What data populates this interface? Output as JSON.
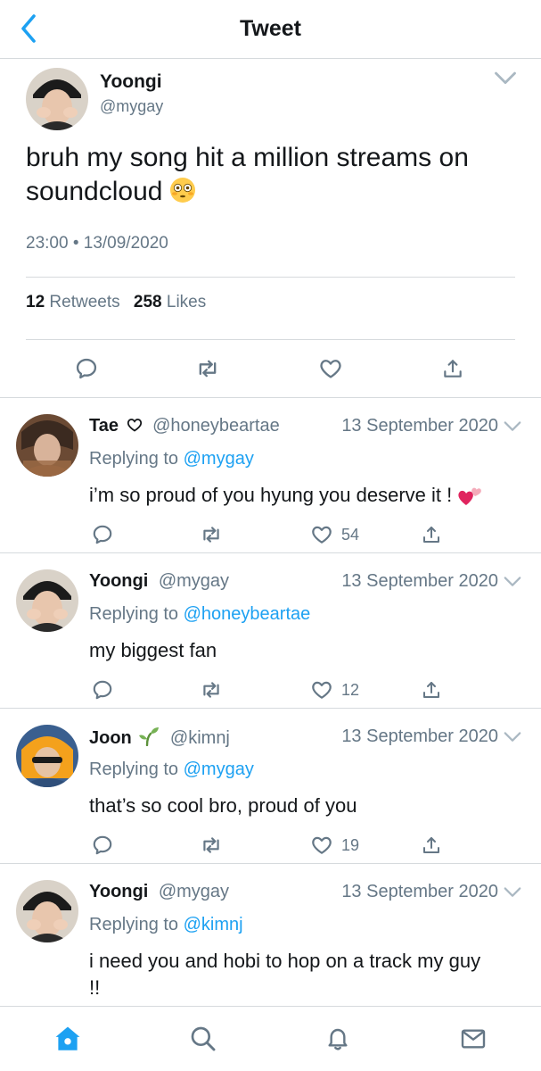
{
  "header": {
    "title": "Tweet"
  },
  "main_tweet": {
    "name": "Yoongi",
    "handle": "@mygay",
    "text": "bruh my song hit a million streams on soundcloud",
    "emoji": "flushed-face",
    "time": "23:00",
    "separator": "•",
    "date": "13/09/2020",
    "retweets_count": "12",
    "retweets_label": "Retweets",
    "likes_count": "258",
    "likes_label": "Likes"
  },
  "replies": [
    {
      "name": "Tae",
      "name_suffix_icon": "heart-outline-icon",
      "handle": "@honeybeartae",
      "date": "13 September 2020",
      "replying_prefix": "Replying to",
      "replying_to": "@mygay",
      "text": "i’m so proud of you hyung you deserve it !",
      "trailing_emoji": "two-hearts",
      "likes": "54"
    },
    {
      "name": "Yoongi",
      "handle": "@mygay",
      "date": "13 September 2020",
      "replying_prefix": "Replying to",
      "replying_to": "@honeybeartae",
      "text": "my biggest fan",
      "likes": "12"
    },
    {
      "name": "Joon",
      "name_suffix_icon": "seedling-icon",
      "handle": "@kimnj",
      "date": "13 September 2020",
      "replying_prefix": "Replying to",
      "replying_to": "@mygay",
      "text": "that’s so cool bro, proud of you",
      "likes": "19"
    },
    {
      "name": "Yoongi",
      "handle": "@mygay",
      "date": "13 September 2020",
      "replying_prefix": "Replying to",
      "replying_to": "@kimnj",
      "text": "i need you and hobi to hop on a track my guy !!"
    }
  ],
  "tabbar": {
    "items": [
      "home-icon",
      "search-icon",
      "bell-icon",
      "mail-icon"
    ]
  },
  "colors": {
    "accent": "#1da1f2",
    "text": "#14171a",
    "muted": "#657786",
    "divider": "#d6dadd",
    "like_emoji": "#e0245e"
  }
}
